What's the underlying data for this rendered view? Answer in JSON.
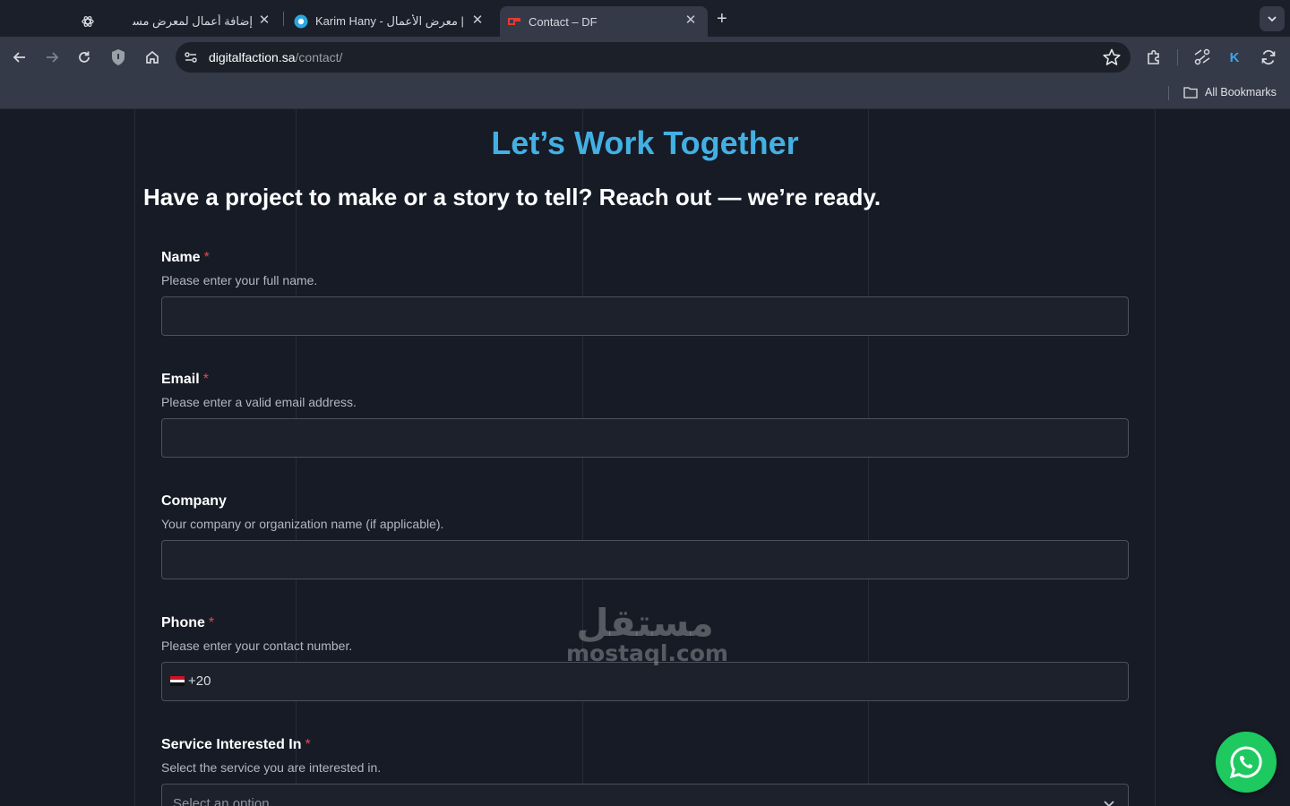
{
  "browser": {
    "tabs": [
      {
        "title": "إضافة أعمال لمعرض مستقل",
        "icon": "openai-icon"
      },
      {
        "title": "Karim Hany - مستقل | معرض الأعمال",
        "icon": "mostaql-icon"
      },
      {
        "title": "Contact – DF",
        "icon": "df-icon",
        "active": true
      }
    ],
    "new_tab_label": "+",
    "url_host": "digitalfaction.sa",
    "url_path": "/contact/",
    "profile_initial": "K",
    "bookmarks_label": "All Bookmarks"
  },
  "page": {
    "heading": "Let’s Work Together",
    "subheading": "Have a project to make or a story to tell? Reach out — we’re ready.",
    "required_mark": "*",
    "fields": {
      "name": {
        "label": "Name",
        "hint": "Please enter your full name."
      },
      "email": {
        "label": "Email",
        "hint": "Please enter a valid email address."
      },
      "company": {
        "label": "Company",
        "hint": "Your company or organization name (if applicable)."
      },
      "phone": {
        "label": "Phone",
        "hint": "Please enter your contact number.",
        "prefix": "+20"
      },
      "service": {
        "label": "Service Interested In",
        "hint": "Select the service you are interested in.",
        "placeholder": "Select an option"
      }
    },
    "watermark": {
      "arabic": "مستقل",
      "latin": "mostaql.com"
    }
  },
  "colors": {
    "accent": "#43b0e3",
    "required": "#e5484d",
    "whatsapp": "#1ec95f"
  }
}
